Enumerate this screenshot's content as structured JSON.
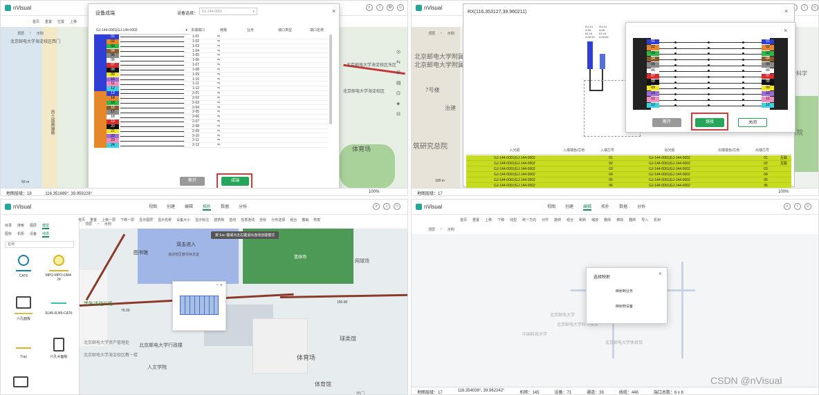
{
  "q1": {
    "app": "nVisual",
    "toolbar": [
      "首页",
      "重置",
      "位置",
      "上移"
    ],
    "breadcrumb": [
      "顶层",
      "示例"
    ],
    "dialog_title": "设备成端",
    "device_select_label": "设备选择：",
    "device_select_value": "GJ-144-0002",
    "fiber_select": "GJ-144-0001|GJ-144-0002",
    "headers": [
      "本端端口",
      "链路",
      "业务",
      "端口类型",
      "端口名称"
    ],
    "ports": [
      "1-01",
      "1-02",
      "1-03",
      "1-04",
      "1-05",
      "1-06",
      "1-07",
      "1-08",
      "1-09",
      "1-10",
      "1-11",
      "1-12",
      "2-01",
      "2-02",
      "2-03",
      "2-04",
      "2-05",
      "2-06",
      "2-07",
      "2-08",
      "2-09",
      "2-10",
      "2-11",
      "2-12"
    ],
    "fibers": [
      "01",
      "02",
      "03",
      "04",
      "05",
      "06",
      "07",
      "08",
      "09",
      "10",
      "11",
      "12",
      "13",
      "14",
      "15",
      "16",
      "17",
      "18",
      "19",
      "20",
      "21",
      "22",
      "23",
      "24"
    ],
    "btn_cancel": "断开",
    "btn_ok": "成端",
    "map_labels": [
      "北京邮电大学海淀校区西门",
      "西土城路辅路",
      "北京邮电大学海淀校区东区",
      "北京邮电大学海淀校区",
      "体育场"
    ],
    "status": "地图层级：18",
    "coords": "116.351689°, 39.959228°",
    "zoom": "100%",
    "scale": "50 m"
  },
  "q2": {
    "app": "nVisual",
    "dialog_title": "RX(116.353127,39.960211)",
    "cable_a": "GJ-14 4-00 01-14 4-00 02",
    "cable_b": "GJ-14 4-00 01-14 4-00 02",
    "fibers": [
      "01",
      "02",
      "03",
      "04",
      "05",
      "06",
      "07",
      "08",
      "09",
      "10",
      "11",
      "12"
    ],
    "btn_cancel": "断开",
    "btn_ok": "熔接",
    "btn_close": "关闭",
    "breadcrumb": [
      "顶层",
      "示例"
    ],
    "map_labels": [
      "北京邮电大学附属学院",
      "北京邮电大学附属中学",
      "生命科学",
      "7号楼",
      "治建",
      "筑研究总院",
      "东院"
    ],
    "headers": [
      "入光缆",
      "入端端色/芯色",
      "入端芯号",
      "出光缆",
      "出端端色/芯色",
      "出端芯号"
    ],
    "rows": [
      [
        "GJ-144-0001|GJ-144-0002",
        "01",
        "GJ-144-0001|GJ-144-0002",
        "01",
        "互联"
      ],
      [
        "GJ-144-0001|GJ-144-0002",
        "02",
        "GJ-144-0001|GJ-144-0002",
        "02",
        "互联"
      ],
      [
        "GJ-144-0001|GJ-144-0002",
        "03",
        "GJ-144-0001|GJ-144-0002",
        "03",
        ""
      ],
      [
        "GJ-144-0001|GJ-144-0002",
        "04",
        "GJ-144-0001|GJ-144-0002",
        "04",
        ""
      ],
      [
        "GJ-144-0001|GJ-144-0002",
        "05",
        "GJ-144-0001|GJ-144-0002",
        "05",
        ""
      ],
      [
        "GJ-144-0001|GJ-144-0002",
        "06",
        "GJ-144-0001|GJ-144-0002",
        "06",
        ""
      ]
    ],
    "status": "地图层级：17",
    "scale": "100 m",
    "zoom": "100%"
  },
  "q3": {
    "app": "nVisual",
    "tabs": [
      "视图",
      "创建",
      "编辑",
      "拓扑",
      "数据",
      "分析"
    ],
    "active_tab": "拓扑",
    "toolbar": [
      "首页",
      "重置",
      "上移一层",
      "下移一层",
      "显示图层",
      "显示名称",
      "设备大小",
      "显示标注",
      "建筑物",
      "直线",
      "任意连线",
      "坐标",
      "分布选择",
      "组合",
      "撤销",
      "恢复"
    ],
    "left_tabs": [
      "目录",
      "搜索",
      "图层",
      "模型"
    ],
    "sub_tabs": [
      "图标",
      "机柜",
      "设备",
      "线缆"
    ],
    "search_placeholder": "名称",
    "breadcrumb": [
      "顶层",
      "示例"
    ],
    "hint": "按 Esc 键或点击右键退出连线创建模式",
    "palette": [
      "CAT6",
      "MPO-MPO-OM4-24",
      "六孔面板",
      "RJ45-RJ45-CAT6",
      "Tray",
      "六孔木面板"
    ],
    "map_labels": [
      "图书馆",
      "双击进入",
      "海淀校区教师休息室",
      "学生活动广场",
      "北京邮电大学资产管理处",
      "北京邮电大学海淀校区教一楼",
      "北京邮电大学行政楼",
      "人文学院",
      "体育场",
      "网球场",
      "篮球场",
      "球类馆",
      "体育馆",
      "南门"
    ],
    "distances": [
      "75.00",
      "150.00"
    ]
  },
  "q4": {
    "app": "nVisual",
    "tabs": [
      "视图",
      "创建",
      "编辑",
      "拓扑",
      "数据",
      "分析"
    ],
    "active_tab": "编辑",
    "toolbar": [
      "首页",
      "重置",
      "上移",
      "下移",
      "线型",
      "统一方向",
      "对齐",
      "旋转",
      "组合",
      "刷新",
      "缩放",
      "删除",
      "移除",
      "翻转",
      "导入",
      "影射"
    ],
    "breadcrumb": [
      "顶层",
      "示例"
    ],
    "dialog_title": "选择映射",
    "option1": "映射到业务",
    "option2": "映射到设备",
    "map_labels": [
      "北京邮电大学",
      "北京邮电大学科学技术",
      "北京邮电大学体育馆",
      "中国科技大学"
    ],
    "status_items": [
      "地图层级：17",
      "116.354038°, 39.962242°",
      "机柜：145",
      "设备：71",
      "通道：39",
      "线缆：446",
      "端口总数：6 x 8"
    ],
    "watermark": "CSDN @nVisual"
  }
}
